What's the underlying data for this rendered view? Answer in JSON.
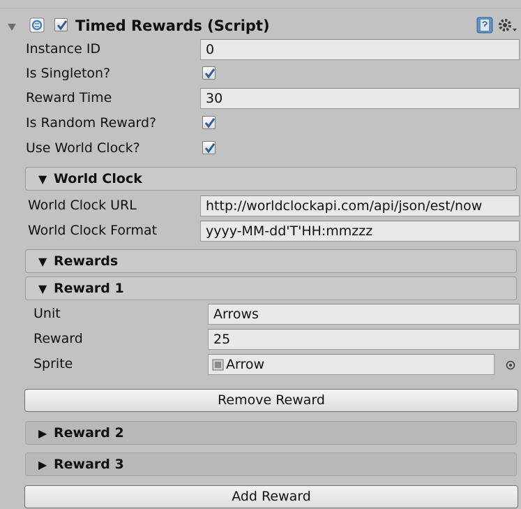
{
  "header": {
    "title": "Timed Rewards (Script)",
    "enabled": true
  },
  "fields": {
    "instance_id": {
      "label": "Instance ID",
      "value": "0"
    },
    "is_singleton": {
      "label": "Is Singleton?",
      "checked": true
    },
    "reward_time": {
      "label": "Reward Time",
      "value": "30"
    },
    "is_random_reward": {
      "label": "Is Random Reward?",
      "checked": true
    },
    "use_world_clock": {
      "label": "Use World Clock?",
      "checked": true
    }
  },
  "world_clock": {
    "title": "World Clock",
    "url": {
      "label": "World Clock URL",
      "value": "http://worldclockapi.com/api/json/est/now"
    },
    "format": {
      "label": "World Clock Format",
      "value": "yyyy-MM-dd'T'HH:mmzzz"
    }
  },
  "rewards": {
    "title": "Rewards",
    "reward_1": {
      "title": "Reward 1",
      "unit": {
        "label": "Unit",
        "value": "Arrows"
      },
      "reward": {
        "label": "Reward",
        "value": "25"
      },
      "sprite": {
        "label": "Sprite",
        "value": "Arrow"
      },
      "remove_label": "Remove Reward"
    },
    "reward_2": {
      "title": "Reward 2"
    },
    "reward_3": {
      "title": "Reward 3"
    },
    "add_label": "Add Reward"
  },
  "icons": {
    "foldout": "triangle-down",
    "script": "script-icon",
    "help": "help-book-icon",
    "settings": "gear-icon",
    "object_picker": "object-picker-icon"
  },
  "colors": {
    "background": "#c2c2c2",
    "checkbox_check": "#2b5f9e",
    "script_icon": "#3f82c9"
  }
}
